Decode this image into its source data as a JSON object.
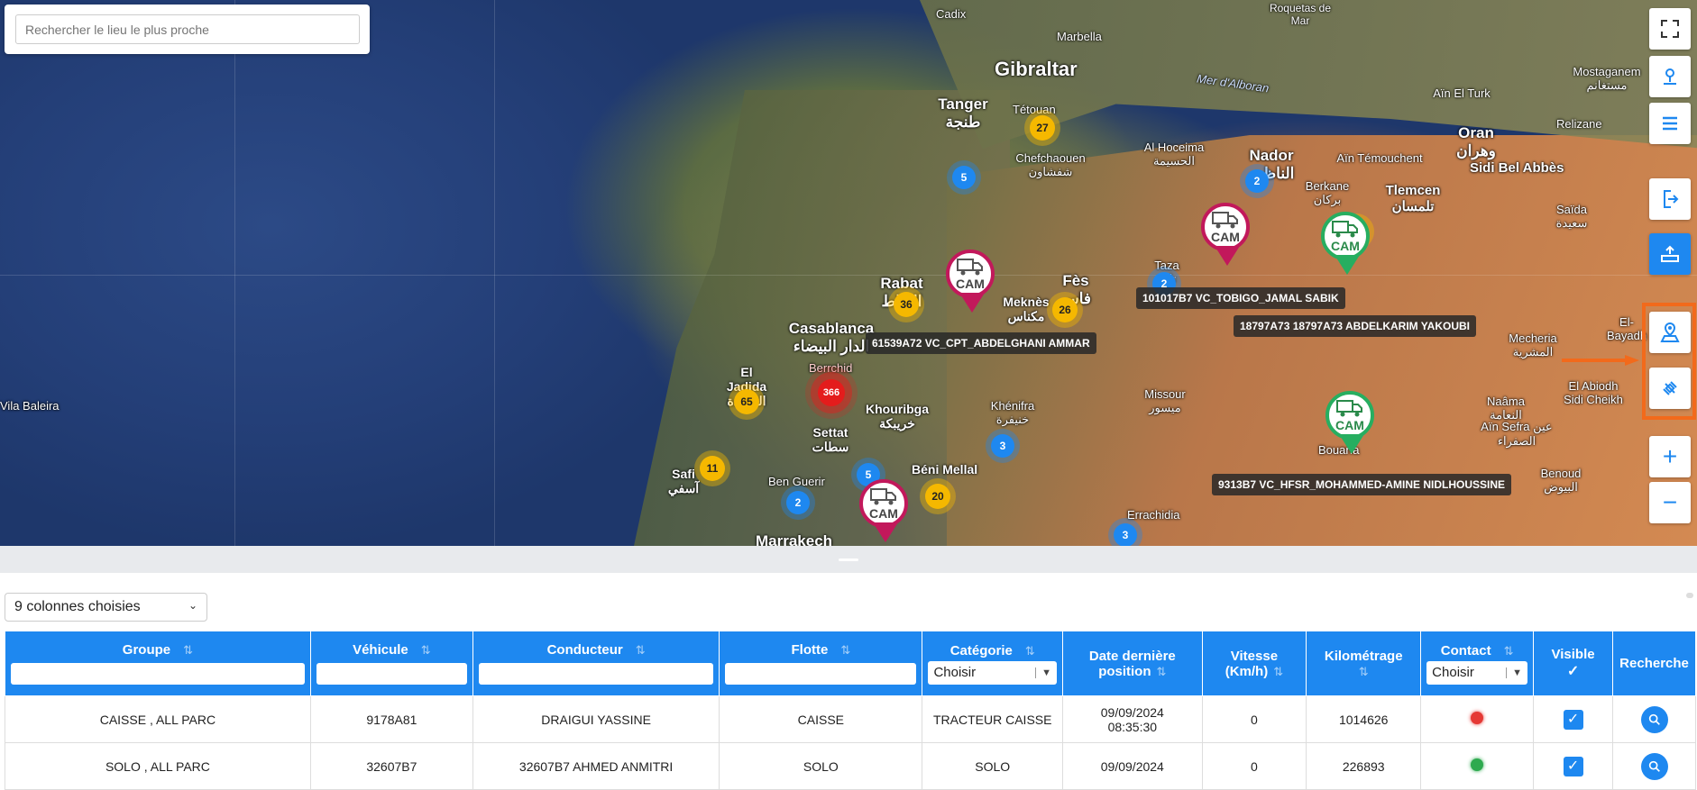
{
  "search": {
    "placeholder": "Rechercher le lieu le plus proche"
  },
  "map": {
    "cities": [
      {
        "name": "Cadix",
        "cls": "city"
      },
      {
        "name": "Marbella",
        "cls": "city"
      },
      {
        "name": "Roquetas de Mar",
        "cls": "city"
      },
      {
        "name": "Gibraltar",
        "cls": "city xl"
      },
      {
        "name": "Tanger طنجة",
        "cls": "city big"
      },
      {
        "name": "Tétouan",
        "cls": "city"
      },
      {
        "name": "Chefchaouen شفشاون",
        "cls": "city"
      },
      {
        "name": "Mer d'Alboran",
        "cls": "city sea"
      },
      {
        "name": "Al Hoceima الحسيمة",
        "cls": "city"
      },
      {
        "name": "Nador الناظور",
        "cls": "city big"
      },
      {
        "name": "Aïn Témouchent",
        "cls": "city"
      },
      {
        "name": "Oran وهران",
        "cls": "city big"
      },
      {
        "name": "Sidi Bel Abbès",
        "cls": "city big"
      },
      {
        "name": "Tlemcen تلمسان",
        "cls": "city big"
      },
      {
        "name": "Berkane بركان",
        "cls": "city"
      },
      {
        "name": "Rabat الرباط",
        "cls": "city big"
      },
      {
        "name": "Meknès مكناس",
        "cls": "city big"
      },
      {
        "name": "Fès فاس",
        "cls": "city big"
      },
      {
        "name": "Taza تازة",
        "cls": "city"
      },
      {
        "name": "Casablanca الدار البيضاء",
        "cls": "city big"
      },
      {
        "name": "El Jadida الجديدة",
        "cls": "city big"
      },
      {
        "name": "Berrchid",
        "cls": "city"
      },
      {
        "name": "Settat سطات",
        "cls": "city big"
      },
      {
        "name": "Khouribga خريبكة",
        "cls": "city big"
      },
      {
        "name": "Khénifra خنيفرة",
        "cls": "city"
      },
      {
        "name": "Missour ميسور",
        "cls": "city"
      },
      {
        "name": "Béni Mellal",
        "cls": "city big"
      },
      {
        "name": "Safi آسفي",
        "cls": "city big"
      },
      {
        "name": "Ben Guerir",
        "cls": "city"
      },
      {
        "name": "Marrakech",
        "cls": "city big"
      },
      {
        "name": "Errachidia",
        "cls": "city"
      },
      {
        "name": "Mecheria المشرية",
        "cls": "city"
      },
      {
        "name": "Naâma النعامة",
        "cls": "city"
      },
      {
        "name": "Aïn Sefra عين الصفراء",
        "cls": "city"
      },
      {
        "name": "El Abiodh Sidi Cheikh",
        "cls": "city"
      },
      {
        "name": "Benoud البيوض",
        "cls": "city"
      },
      {
        "name": "El-Bayadh",
        "cls": "city"
      },
      {
        "name": "Saïda سعيدة",
        "cls": "city"
      },
      {
        "name": "Relizane",
        "cls": "city"
      },
      {
        "name": "Mostaganem مستغانم",
        "cls": "city"
      },
      {
        "name": "Aïn El Turk",
        "cls": "city"
      },
      {
        "name": "Bouarfa",
        "cls": "city"
      },
      {
        "name": "Vila Baleira",
        "cls": "city"
      }
    ],
    "clusters": [
      {
        "count": "27",
        "color": "yellow"
      },
      {
        "count": "5",
        "color": "blue"
      },
      {
        "count": "2",
        "color": "blue"
      },
      {
        "count": "31",
        "color": "yellow"
      },
      {
        "count": "36",
        "color": "yellow"
      },
      {
        "count": "26",
        "color": "yellow"
      },
      {
        "count": "2",
        "color": "blue"
      },
      {
        "count": "65",
        "color": "yellow"
      },
      {
        "count": "366",
        "color": "red"
      },
      {
        "count": "3",
        "color": "blue"
      },
      {
        "count": "11",
        "color": "yellow"
      },
      {
        "count": "5",
        "color": "blue"
      },
      {
        "count": "2",
        "color": "blue"
      },
      {
        "count": "20",
        "color": "yellow"
      },
      {
        "count": "3",
        "color": "blue"
      }
    ],
    "pins": [
      {
        "text": "CAM",
        "color": "red"
      },
      {
        "text": "CAM",
        "color": "red"
      },
      {
        "text": "CAM",
        "color": "green"
      },
      {
        "text": "CAM",
        "color": "green"
      },
      {
        "text": "CAM",
        "color": "red"
      }
    ],
    "vehicle_labels": [
      "61539A72 VC_CPT_ABDELGHANI AMMAR",
      "101017B7 VC_TOBIGO_JAMAL SABIK",
      "18797A73 18797A73 ABDELKARIM YAKOUBI",
      "9313B7 VC_HFSR_MOHAMMED-AMINE NIDLHOUSSINE"
    ]
  },
  "controls": {
    "fullscreen": "fullscreen-icon",
    "person_pin": "person-pin-icon",
    "list": "list-icon",
    "exit": "exit-icon",
    "layers": "layers-upload-icon",
    "geo_user": "geo-user-icon",
    "satellite": "satellite-icon",
    "zoom_in": "+",
    "zoom_out": "−",
    "accent": "#1e88f0",
    "highlight_color": "#f26a1b"
  },
  "columns_selector": {
    "label": "9 colonnes choisies"
  },
  "table": {
    "headers": {
      "groupe": "Groupe",
      "vehicule": "Véhicule",
      "conducteur": "Conducteur",
      "flotte": "Flotte",
      "categorie": "Catégorie",
      "categorie_select": "Choisir",
      "date": "Date dernière position",
      "vitesse": "Vitesse (Km/h)",
      "km": "Kilométrage",
      "contact": "Contact",
      "contact_select": "Choisir",
      "visible": "Visible",
      "recherche": "Recherche"
    },
    "rows": [
      {
        "groupe": "CAISSE , ALL PARC",
        "vehicule": "9178A81",
        "conducteur": "DRAIGUI YASSINE",
        "flotte": "CAISSE",
        "categorie": "TRACTEUR CAISSE",
        "date": "09/09/2024 08:35:30",
        "vitesse": "0",
        "km": "1014626",
        "contact": "#e53935",
        "visible": true
      },
      {
        "groupe": "SOLO , ALL PARC",
        "vehicule": "32607B7",
        "conducteur": "32607B7 AHMED ANMITRI",
        "flotte": "SOLO",
        "categorie": "SOLO",
        "date": "09/09/2024",
        "vitesse": "0",
        "km": "226893",
        "contact": "#2eaa4f",
        "visible": true
      }
    ]
  }
}
